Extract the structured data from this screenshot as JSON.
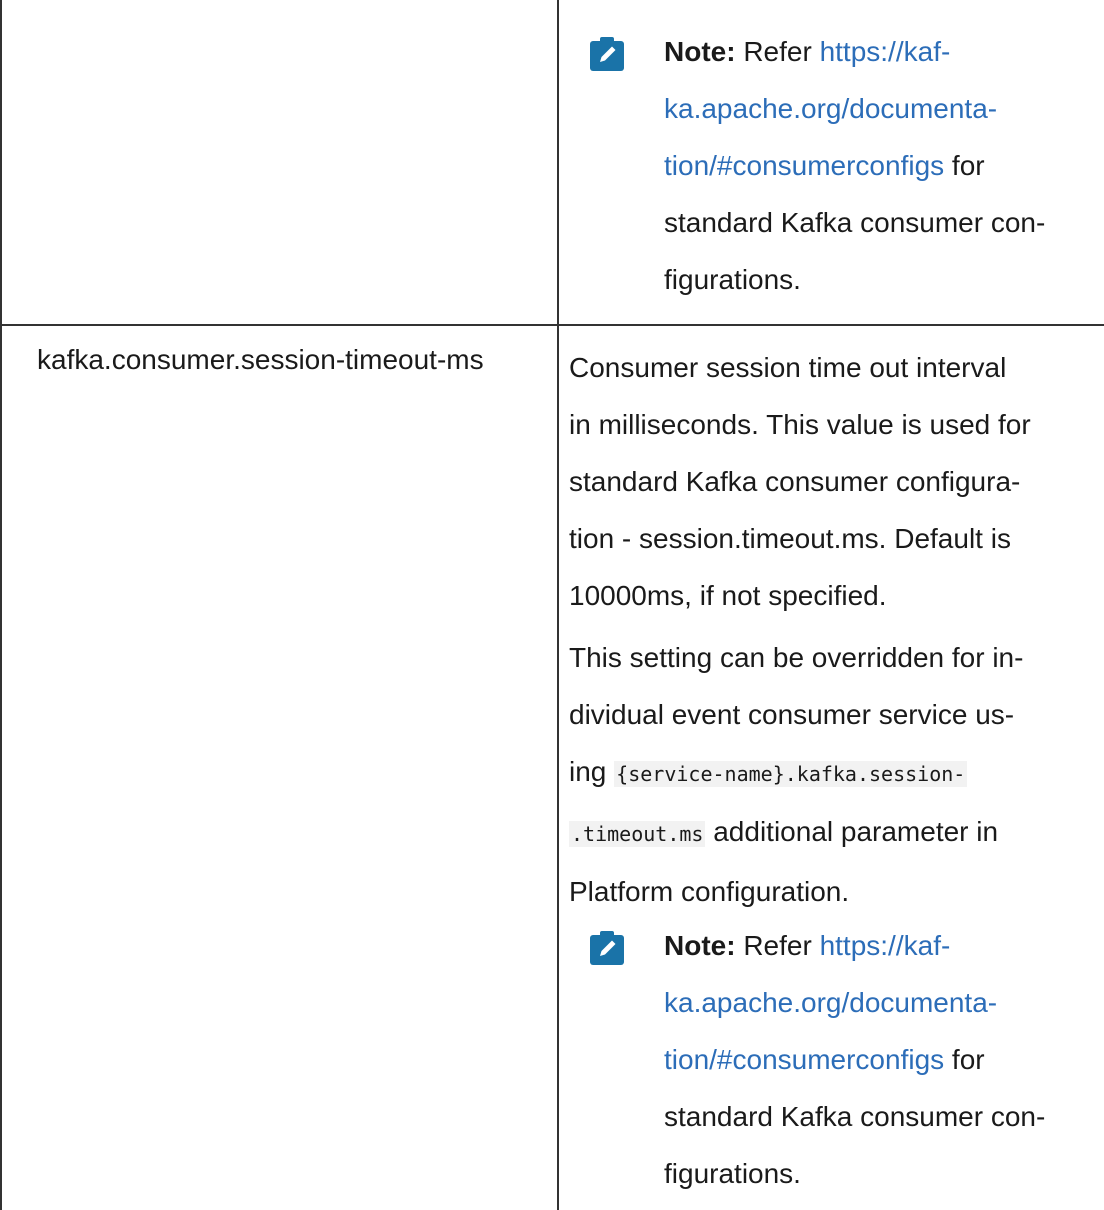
{
  "note_top": {
    "label": "Note:",
    "prefix": " Refer ",
    "link_lines": [
      "https://kaf-",
      "ka.apache.org/documenta-",
      "tion/#consumerconfigs"
    ],
    "suffix_first": " for",
    "rest_lines": [
      "standard Kafka consumer con-",
      "figurations."
    ]
  },
  "row": {
    "param_name": "kafka.consumer.session-timeout-ms",
    "desc_lines": [
      "Consumer session time out interval",
      "in milliseconds. This value is used for",
      "standard Kafka consumer configura-",
      "tion - session.timeout.ms. Default is",
      "10000ms, if not specified."
    ],
    "override_line1": "This setting can be overridden for in-",
    "override_line2": "dividual event consumer service us-",
    "override_line3_prefix": "ing ",
    "override_code1": "{service-name}.kafka.session-",
    "override_code2": ".timeout.ms",
    "override_line4_suffix": " additional parameter in",
    "override_line5": "Platform configuration."
  },
  "note_bottom": {
    "label": "Note:",
    "prefix": " Refer ",
    "link_lines": [
      "https://kaf-",
      "ka.apache.org/documenta-",
      "tion/#consumerconfigs"
    ],
    "suffix_first": " for",
    "rest_lines": [
      "standard Kafka consumer con-",
      "figurations."
    ]
  },
  "colors": {
    "link": "#2c6db8",
    "icon": "#1a73a8",
    "border": "#333333"
  },
  "icons": {
    "note": "pencil-note-icon"
  }
}
